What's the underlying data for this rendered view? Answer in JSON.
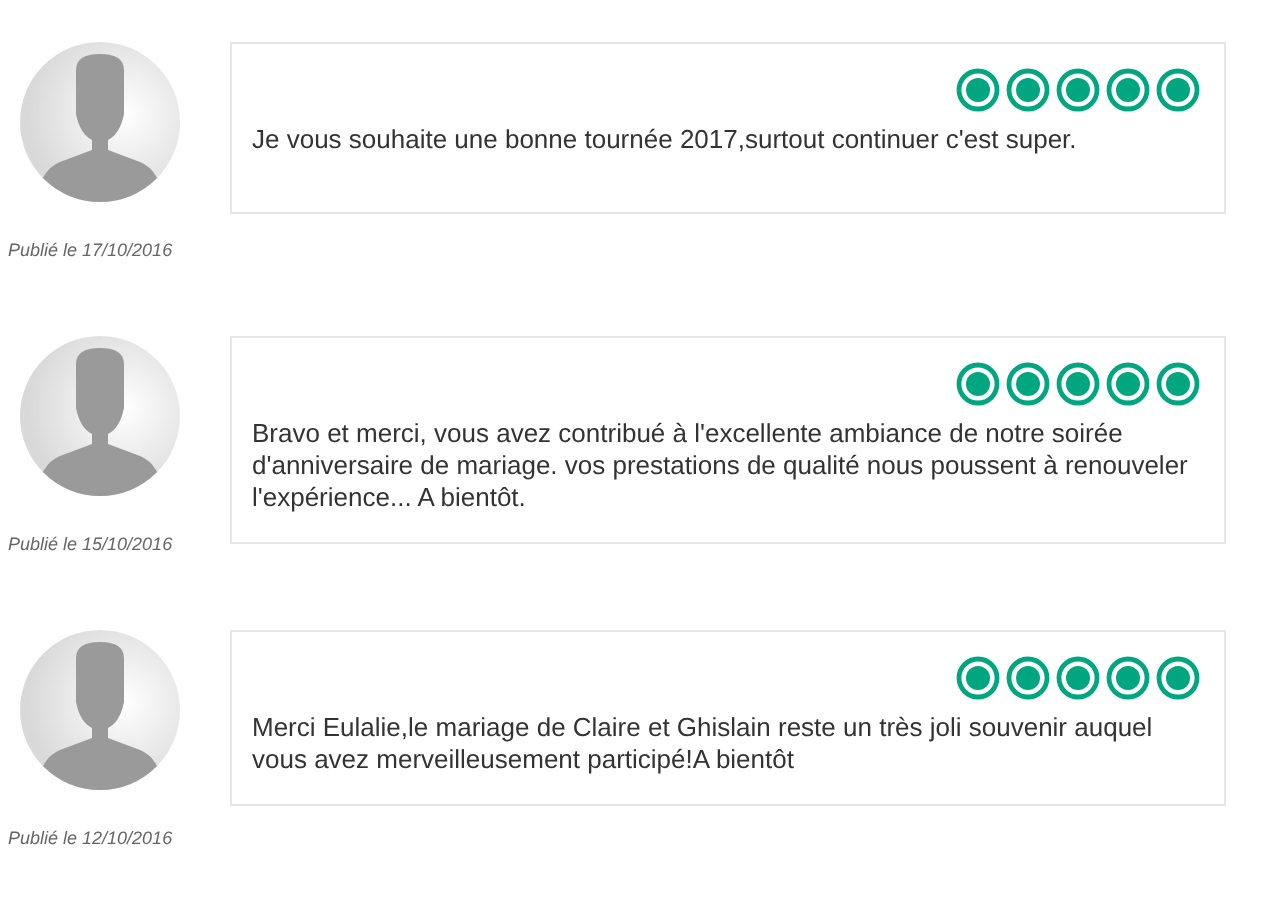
{
  "reviews": [
    {
      "stars": 5,
      "text": "Je vous souhaite une bonne tournée 2017,surtout continuer c'est super.",
      "date": "Publié le 17/10/2016"
    },
    {
      "stars": 5,
      "text": "Bravo et merci, vous avez contribué à l'excellente ambiance de notre soirée d'anniversaire de mariage. vos prestations de qualité nous poussent à renouveler l'expérience... A bientôt.",
      "date": "Publié le 15/10/2016"
    },
    {
      "stars": 5,
      "text": "Merci Eulalie,le mariage de Claire et Ghislain reste un très joli souvenir auquel vous avez merveilleusement participé!A bientôt",
      "date": "Publié le 12/10/2016"
    }
  ]
}
